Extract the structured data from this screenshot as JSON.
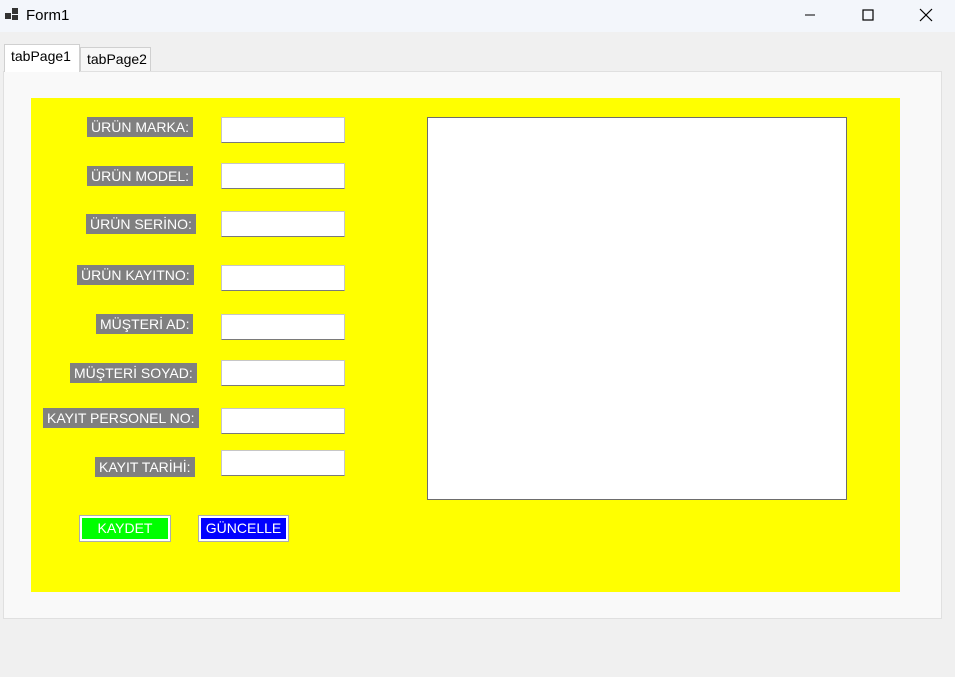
{
  "window": {
    "title": "Form1",
    "controls": {
      "minimize": "—",
      "maximize": "☐",
      "close": "✕"
    }
  },
  "tabs": [
    {
      "label": "tabPage1",
      "active": true
    },
    {
      "label": "tabPage2",
      "active": false
    }
  ],
  "form": {
    "background": "#ffff00",
    "fields": [
      {
        "label": "ÜRÜN MARKA:",
        "value": ""
      },
      {
        "label": "ÜRÜN MODEL:",
        "value": ""
      },
      {
        "label": "ÜRÜN SERİNO:",
        "value": ""
      },
      {
        "label": "ÜRÜN KAYITNO:",
        "value": ""
      },
      {
        "label": "MÜŞTERİ AD:",
        "value": ""
      },
      {
        "label": "MÜŞTERİ SOYAD:",
        "value": ""
      },
      {
        "label": "KAYIT PERSONEL NO:",
        "value": ""
      },
      {
        "label": "KAYIT TARİHİ:",
        "value": ""
      }
    ],
    "buttons": {
      "save_label": "KAYDET",
      "save_color": "#00ff00",
      "update_label": "GÜNCELLE",
      "update_color": "#0000ff"
    }
  }
}
